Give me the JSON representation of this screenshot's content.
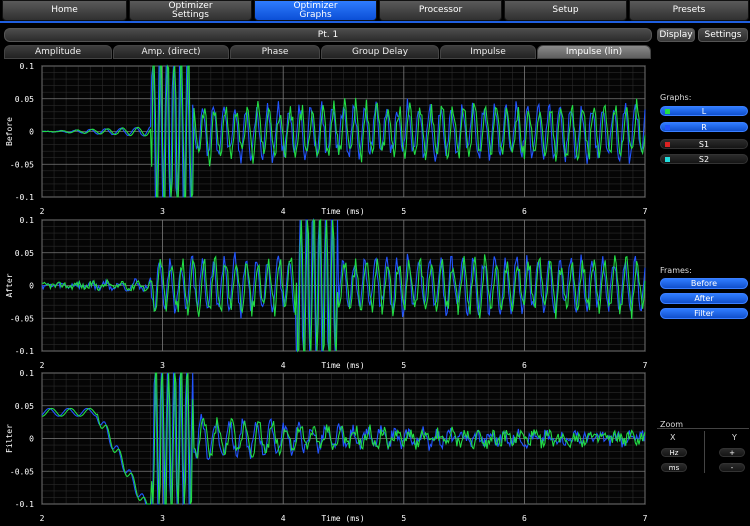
{
  "nav": [
    "Home",
    "Optimizer\nSettings",
    "Optimizer\nGraphs",
    "Processor",
    "Setup",
    "Presets"
  ],
  "nav_active": 2,
  "header": {
    "title": "Pt. 1"
  },
  "side_tabs": [
    "Display",
    "Settings"
  ],
  "tabs": [
    "Amplitude",
    "Amp. (direct)",
    "Phase",
    "Group Delay",
    "Impulse",
    "Impulse (lin)"
  ],
  "tab_active": 5,
  "graphs": {
    "label": "Graphs:",
    "items": [
      {
        "label": "L",
        "color": "#22dd44",
        "on": true
      },
      {
        "label": "R",
        "color": "#2255ff",
        "on": true
      },
      {
        "label": "S1",
        "color": "#dd2222",
        "on": false
      },
      {
        "label": "S2",
        "color": "#22dddd",
        "on": false
      }
    ]
  },
  "frames": {
    "label": "Frames:",
    "items": [
      "Before",
      "After",
      "Filter"
    ]
  },
  "zoom": {
    "label": "Zoom",
    "x_label": "X",
    "y_label": "Y",
    "x_buttons": [
      "Hz",
      "ms"
    ],
    "y_buttons": [
      "+",
      "-"
    ]
  },
  "chart_data": [
    {
      "type": "line",
      "ylabel": "Before",
      "xlabel": "Time (ms)",
      "xlim": [
        2,
        7
      ],
      "ylim": [
        -0.1,
        0.1
      ],
      "xticks": [
        "2",
        "3",
        "4",
        "5",
        "6",
        "7"
      ],
      "yticks": [
        "0.1",
        "0.05",
        "0",
        "-0.05",
        "-0.1"
      ],
      "grid": true,
      "series": [
        {
          "name": "L",
          "color": "#22dd44"
        },
        {
          "name": "R",
          "color": "#2255ff"
        }
      ]
    },
    {
      "type": "line",
      "ylabel": "After",
      "xlabel": "Time (ms)",
      "xlim": [
        2,
        7
      ],
      "ylim": [
        -0.1,
        0.1
      ],
      "xticks": [
        "2",
        "3",
        "4",
        "5",
        "6",
        "7"
      ],
      "yticks": [
        "0.1",
        "0.05",
        "0",
        "-0.05",
        "-0.1"
      ],
      "grid": true,
      "series": [
        {
          "name": "L",
          "color": "#22dd44"
        },
        {
          "name": "R",
          "color": "#2255ff"
        }
      ]
    },
    {
      "type": "line",
      "ylabel": "Filter",
      "xlabel": "Time (ms)",
      "xlim": [
        2,
        7
      ],
      "ylim": [
        -0.1,
        0.1
      ],
      "xticks": [
        "2",
        "3",
        "4",
        "5",
        "6",
        "7"
      ],
      "yticks": [
        "0.1",
        "0.05",
        "0",
        "-0.05",
        "-0.1"
      ],
      "grid": true,
      "series": [
        {
          "name": "L",
          "color": "#22dd44"
        },
        {
          "name": "R",
          "color": "#2255ff"
        }
      ]
    }
  ]
}
